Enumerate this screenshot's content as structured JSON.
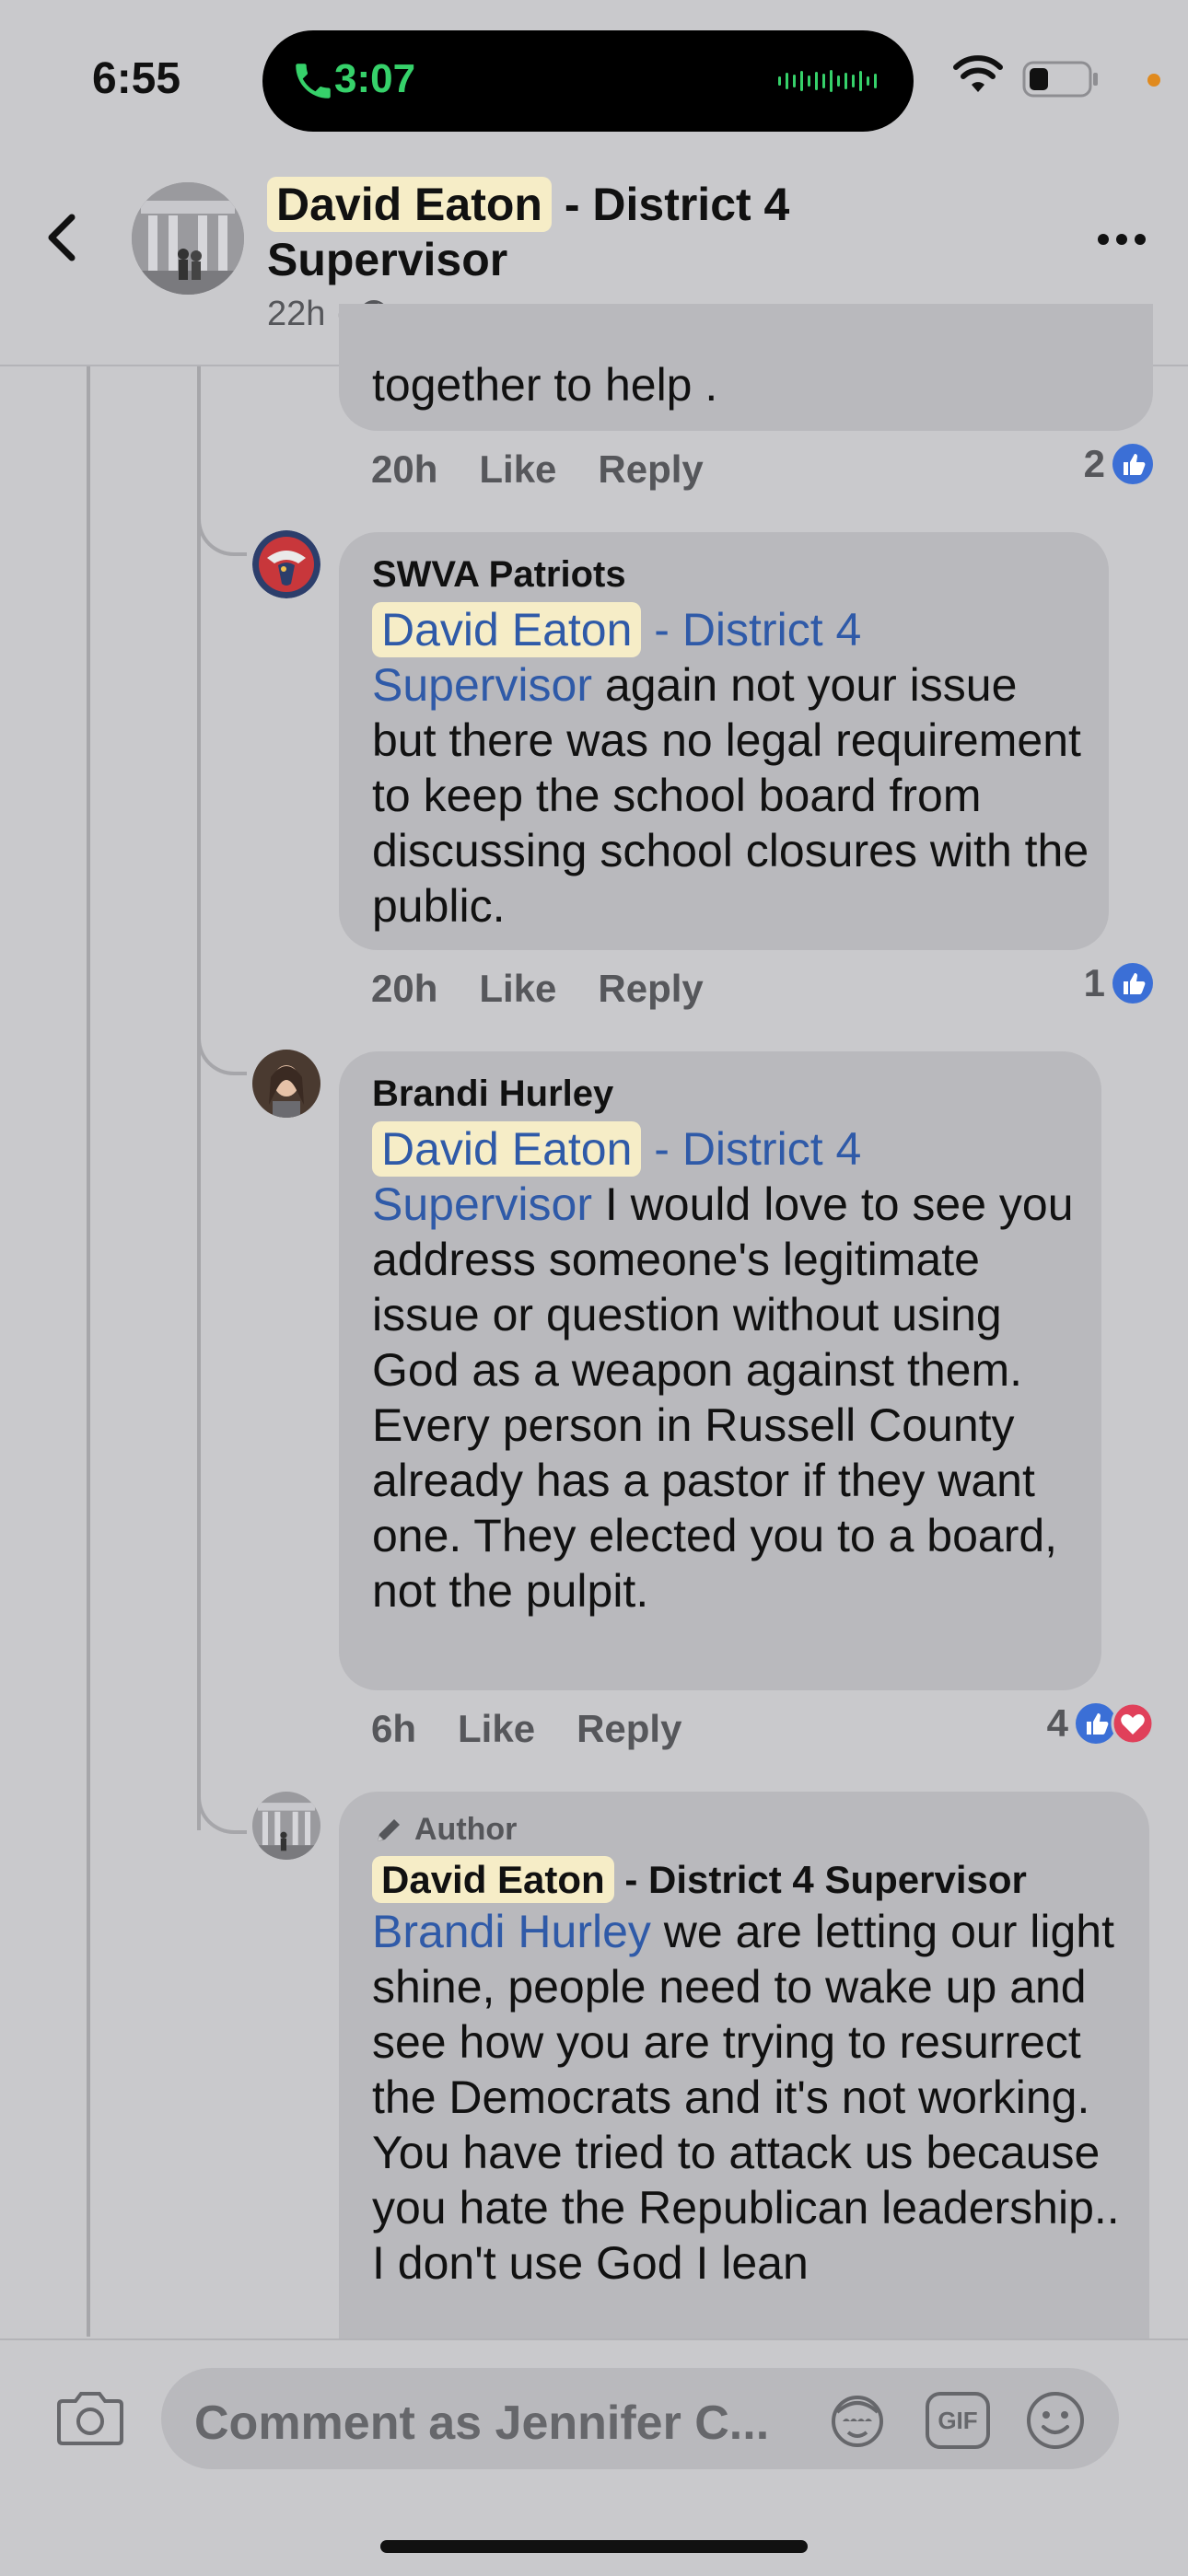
{
  "status_bar": {
    "time": "6:55",
    "call_duration": "3:07"
  },
  "header": {
    "name_highlight": "David Eaton",
    "name_rest": " - District 4 Supervisor",
    "posted_ago": "22h",
    "separator": "·",
    "back_icon": "chevron-left-icon",
    "more_icon": "ellipsis-icon"
  },
  "partial_comment": {
    "text_tail": "together to help .",
    "time": "20h",
    "like_label": "Like",
    "reply_label": "Reply",
    "reaction_count": "2"
  },
  "comments": [
    {
      "author": "SWVA Patriots",
      "mention_highlight": "David Eaton",
      "mention_rest_line1": " - District 4",
      "mention_rest_line2": "Supervisor",
      "body": " again not your issue but there was no legal requirement to keep the school board from discussing school closures with the public.",
      "time": "20h",
      "like_label": "Like",
      "reply_label": "Reply",
      "reaction_count": "1"
    },
    {
      "author": "Brandi Hurley",
      "mention_highlight": "David Eaton",
      "mention_rest_line1": " - District 4",
      "mention_rest_line2": "Supervisor",
      "body": " I would love to see you address someone's legitimate issue or question without using God as a weapon against them. Every person in Russell County already has a pastor if they want one. They elected you to a board, not the pulpit.",
      "time": "6h",
      "like_label": "Like",
      "reply_label": "Reply",
      "reaction_count": "4"
    },
    {
      "badge": "Author",
      "author_highlight": "David Eaton",
      "author_rest": " - District 4 Supervisor",
      "mention": "Brandi Hurley",
      "body_line1": " we are letting our light shine, people need to wake up and see how you are trying to resurrect the Democrats and it's not working.",
      "body_line2": "You have tried to attack us because you hate the Republican leadership.. I don't use God I lean"
    }
  ],
  "composer": {
    "placeholder": "Comment as Jennifer C...",
    "gif_label": "GIF"
  },
  "colors": {
    "background": "#c9c9cc",
    "bubble": "#b9b9bd",
    "mention": "#2f5aa8",
    "highlight": "#f6edc7",
    "like_blue": "#3b6fd6",
    "love_red": "#e0405a",
    "call_green": "#36d16a"
  }
}
